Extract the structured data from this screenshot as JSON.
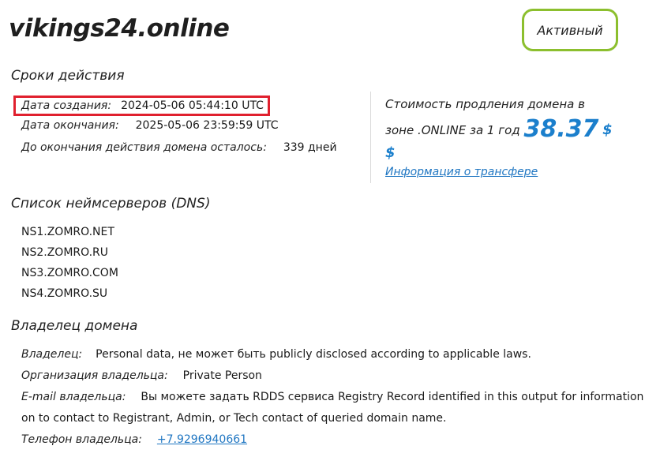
{
  "domain": "vikings24.online",
  "status": "Активный",
  "validity": {
    "title": "Сроки действия",
    "created_label": "Дата создания:",
    "created_value": "2024-05-06 05:44:10 UTC",
    "expires_label": "Дата окончания:",
    "expires_value": "2025-05-06 23:59:59 UTC",
    "remaining_label": "До окончания действия домена осталось:",
    "remaining_value": "339 дней"
  },
  "renewal": {
    "text_line1": "Стоимость продления домена в",
    "text_line2": "зоне .ONLINE за 1 год",
    "amount": "38.37",
    "currency": "$",
    "currency2": "$",
    "transfer_link": "Информация о трансфере"
  },
  "dns": {
    "title": "Список неймсерверов (DNS)",
    "servers": [
      "NS1.ZOMRO.NET",
      "NS2.ZOMRO.RU",
      "NS3.ZOMRO.COM",
      "NS4.ZOMRO.SU"
    ]
  },
  "owner": {
    "title": "Владелец домена",
    "owner_label": "Владелец:",
    "owner_value": "Personal data, не может быть publicly disclosed according to applicable laws.",
    "org_label": "Организация владельца:",
    "org_value": "Private Person",
    "email_label": "E-mail владельца:",
    "email_value_line1": "Вы можете задать RDDS сервиса Registry Record identified in this output for information",
    "email_value_line2": "on to contact to Registrant, Admin, or Tech contact of queried domain name.",
    "phone_label": "Телефон владельца:",
    "phone_value": "+7.9296940661"
  }
}
